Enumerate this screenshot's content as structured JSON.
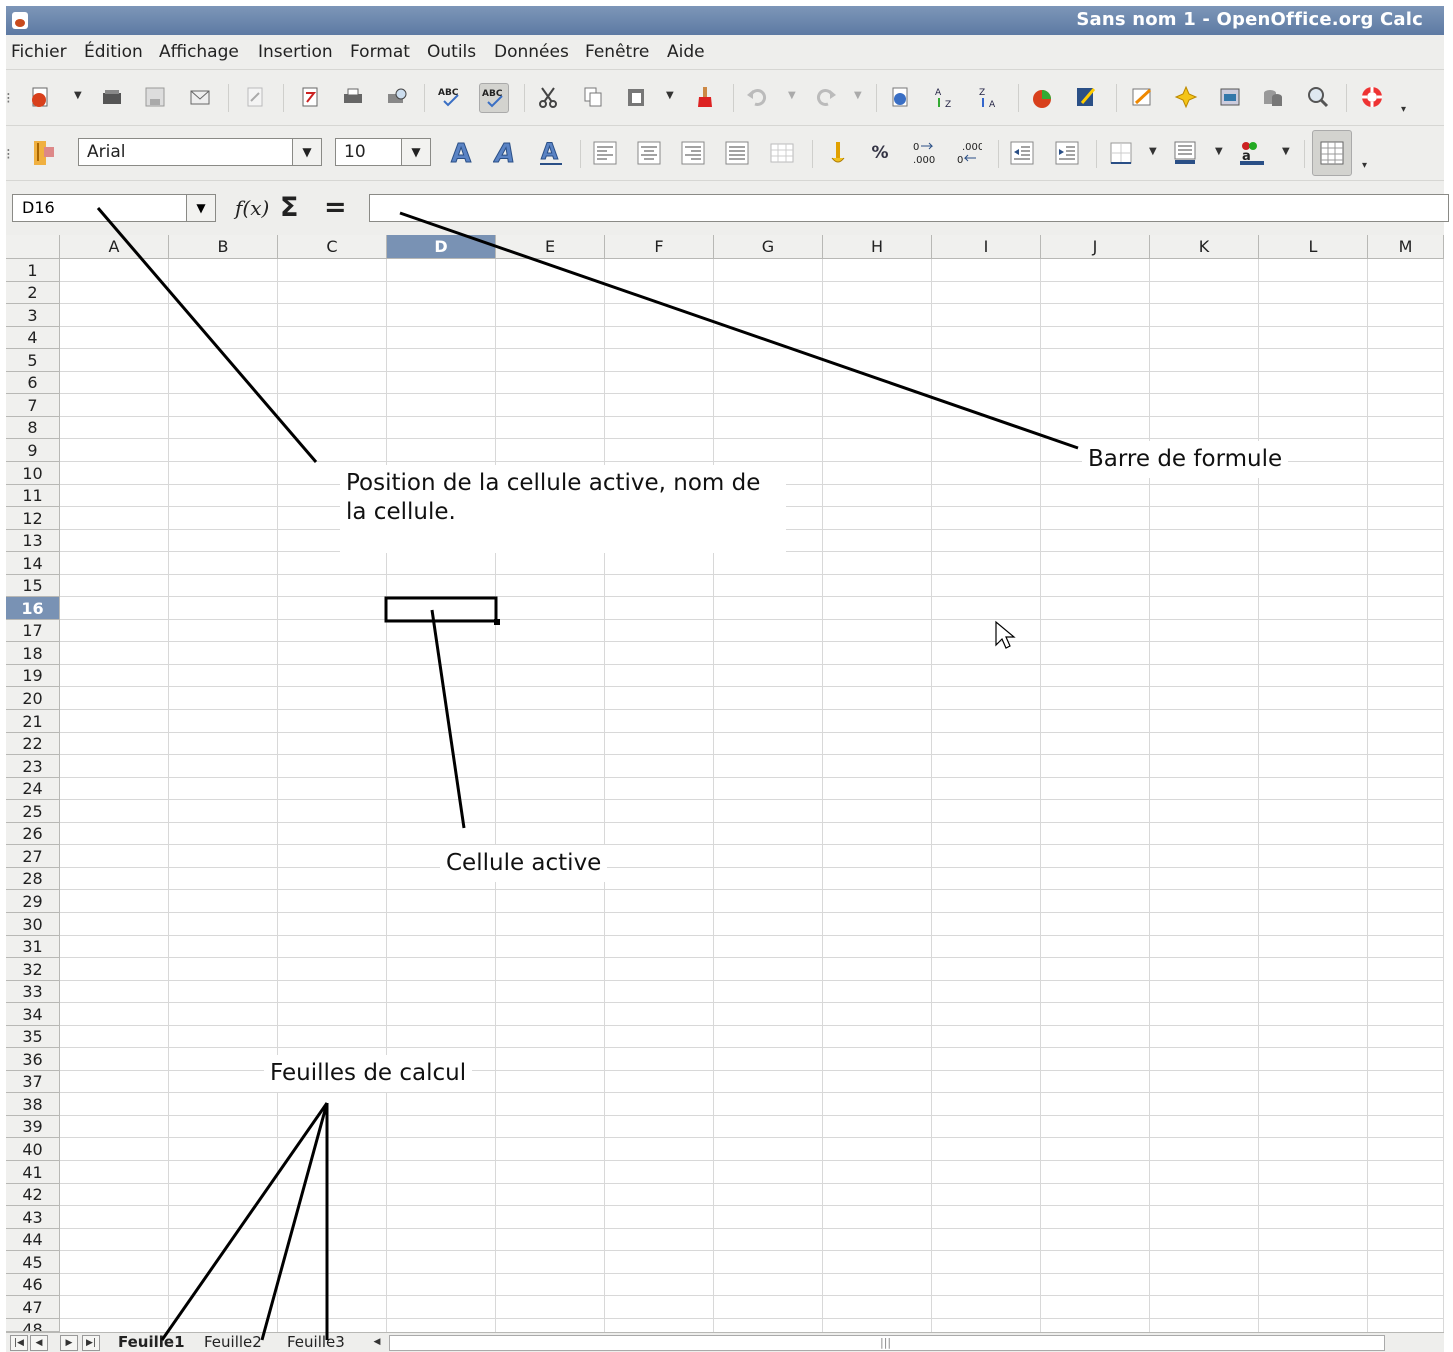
{
  "window": {
    "title": "Sans nom 1 - OpenOffice.org Calc"
  },
  "menubar": {
    "items": [
      "Fichier",
      "Édition",
      "Affichage",
      "Insertion",
      "Format",
      "Outils",
      "Données",
      "Fenêtre",
      "Aide"
    ]
  },
  "toolbar_standard": {
    "tools": [
      "new-document-icon",
      "open-folder-icon",
      "save-icon",
      "email-icon",
      "edit-file-icon",
      "export-pdf-icon",
      "print-icon",
      "print-preview-icon",
      "spellcheck-icon",
      "autospellcheck-icon",
      "cut-icon",
      "copy-icon",
      "paste-icon",
      "clone-format-icon",
      "undo-icon",
      "redo-icon",
      "hyperlink-icon",
      "sort-ascending-icon",
      "sort-descending-icon",
      "chart-icon",
      "show-draw-functions-icon",
      "edit-points-icon",
      "navigator-icon",
      "gallery-icon",
      "data-sources-icon",
      "zoom-icon",
      "help-icon"
    ]
  },
  "toolbar_formatting": {
    "font_name": "Arial",
    "font_size": "10",
    "percent_label": "%",
    "tools": [
      "styles-formatting-icon",
      "bold-icon",
      "italic-icon",
      "underline-icon",
      "align-left-icon",
      "align-center-icon",
      "align-right-icon",
      "justify-icon",
      "merge-cells-icon",
      "currency-icon",
      "percent-icon",
      "add-decimal-icon",
      "delete-decimal-icon",
      "decrease-indent-icon",
      "increase-indent-icon",
      "borders-icon",
      "background-color-icon",
      "font-color-icon",
      "toggle-grid-icon"
    ]
  },
  "formula_bar": {
    "cell_ref": "D16",
    "content": "",
    "sum_label": "Σ",
    "equals_label": "="
  },
  "grid": {
    "columns": [
      "A",
      "B",
      "C",
      "D",
      "E",
      "F",
      "G",
      "H",
      "I",
      "J",
      "K",
      "L",
      "M"
    ],
    "active_column": "D",
    "active_row": 16,
    "row_count": 47,
    "partial_row": "48"
  },
  "annotations": {
    "cell_position": "Position de la cellule active, nom de la cellule.",
    "formula_bar": "Barre de formule",
    "active_cell": "Cellule active",
    "sheets": "Feuilles de calcul"
  },
  "sheets": {
    "tabs": [
      "Feuille1",
      "Feuille2",
      "Feuille3"
    ],
    "active": "Feuille1"
  },
  "colors": {
    "active_header": "#7992b4",
    "titlebar": "#6c86ac",
    "chrome": "#eeeeec"
  }
}
